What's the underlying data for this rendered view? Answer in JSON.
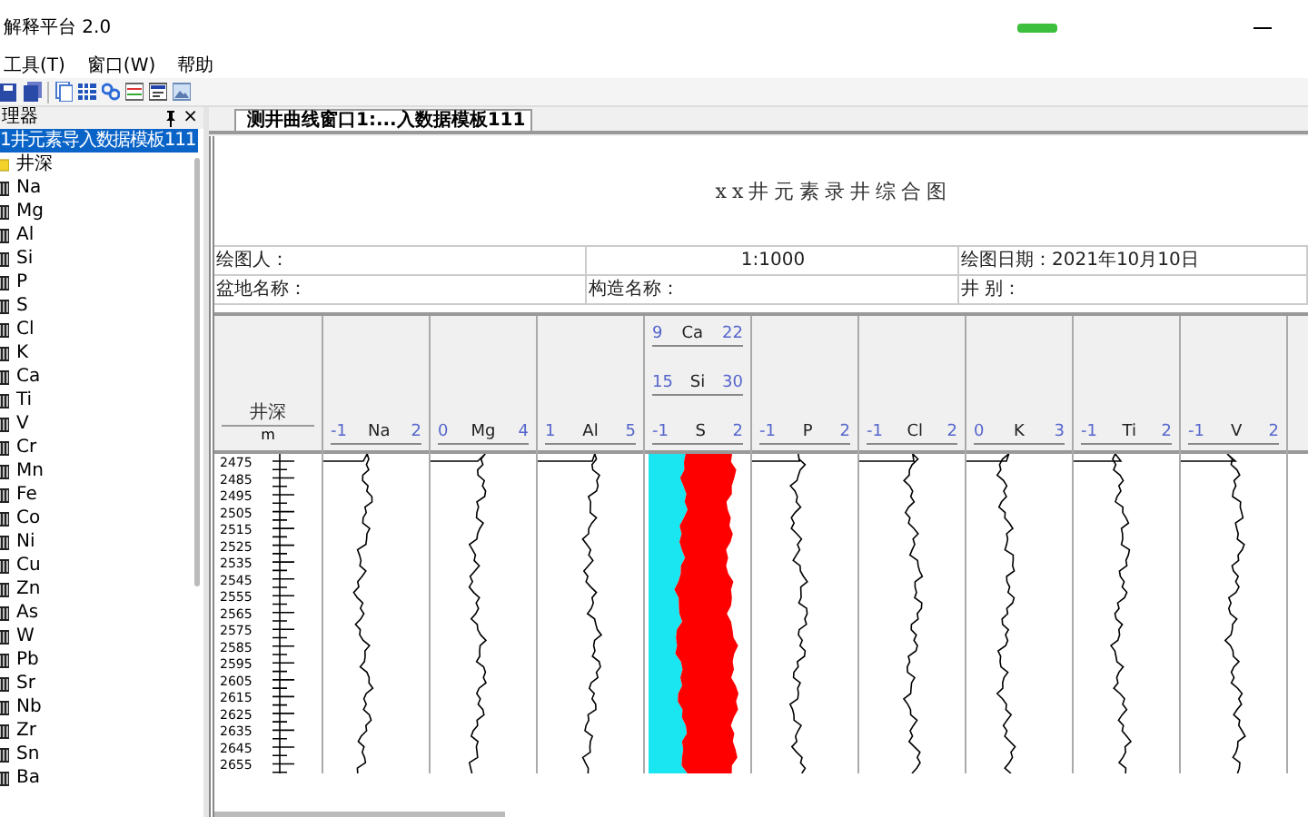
{
  "window": {
    "title": "解释平台 2.0"
  },
  "menu": [
    "工具(T)",
    "窗口(W)",
    "帮助"
  ],
  "panel": {
    "title": "理器",
    "close": "×",
    "root": {
      "label": "1井元素导入数据模板111",
      "selected": true,
      "children": [
        {
          "label": "井深",
          "kind": "folder",
          "selected": false
        },
        {
          "label": "Na",
          "kind": "curve",
          "selected": false
        },
        {
          "label": "Mg",
          "kind": "curve",
          "selected": false
        },
        {
          "label": "Al",
          "kind": "curve",
          "selected": false
        },
        {
          "label": "Si",
          "kind": "curve",
          "selected": false
        },
        {
          "label": "P",
          "kind": "curve",
          "selected": false
        },
        {
          "label": "S",
          "kind": "curve",
          "selected": false
        },
        {
          "label": "Cl",
          "kind": "curve",
          "selected": false
        },
        {
          "label": "K",
          "kind": "curve",
          "selected": false
        },
        {
          "label": "Ca",
          "kind": "curve",
          "selected": false
        },
        {
          "label": "Ti",
          "kind": "curve",
          "selected": false
        },
        {
          "label": "V",
          "kind": "curve",
          "selected": false
        },
        {
          "label": "Cr",
          "kind": "curve",
          "selected": false
        },
        {
          "label": "Mn",
          "kind": "curve",
          "selected": false
        },
        {
          "label": "Fe",
          "kind": "curve",
          "selected": false
        },
        {
          "label": "Co",
          "kind": "curve",
          "selected": false
        },
        {
          "label": "Ni",
          "kind": "curve",
          "selected": false
        },
        {
          "label": "Cu",
          "kind": "curve",
          "selected": false
        },
        {
          "label": "Zn",
          "kind": "curve",
          "selected": false
        },
        {
          "label": "As",
          "kind": "curve",
          "selected": false
        },
        {
          "label": "W",
          "kind": "curve",
          "selected": false
        },
        {
          "label": "Pb",
          "kind": "curve",
          "selected": false
        },
        {
          "label": "Sr",
          "kind": "curve",
          "selected": false
        },
        {
          "label": "Nb",
          "kind": "curve",
          "selected": false
        },
        {
          "label": "Zr",
          "kind": "curve",
          "selected": false
        },
        {
          "label": "Sn",
          "kind": "curve",
          "selected": false
        },
        {
          "label": "Ba",
          "kind": "curve",
          "selected": false
        }
      ]
    }
  },
  "tabs": [
    {
      "label": "测井曲线窗口1:...入数据模板111",
      "selected": true
    }
  ],
  "document": {
    "title": "xx井元素录井综合图",
    "info_rows": [
      [
        "绘图人：",
        "1:1000",
        "绘图日期：2021年10月10日"
      ],
      [
        "盆地名称：",
        "构造名称：",
        "井 别："
      ]
    ],
    "depth_track": {
      "name": "井深",
      "unit": "m",
      "labels": [
        "2475",
        "2485",
        "2495",
        "2505",
        "2515",
        "2525",
        "2535",
        "2545",
        "2555",
        "2565",
        "2575",
        "2585",
        "2595",
        "2605",
        "2615",
        "2625",
        "2635",
        "2645",
        "2655"
      ]
    },
    "tracks": [
      {
        "kind": "curve",
        "name": "Na",
        "min": "-1",
        "max": "2"
      },
      {
        "kind": "curve",
        "name": "Mg",
        "min": "0",
        "max": "4"
      },
      {
        "kind": "curve",
        "name": "Al",
        "min": "1",
        "max": "5"
      },
      {
        "kind": "fill",
        "name": "S",
        "min": "-1",
        "max": "2",
        "extra_scales": [
          {
            "name": "Ca",
            "min": "9",
            "max": "22"
          },
          {
            "name": "Si",
            "min": "15",
            "max": "30"
          }
        ]
      },
      {
        "kind": "curve",
        "name": "P",
        "min": "-1",
        "max": "2"
      },
      {
        "kind": "curve",
        "name": "Cl",
        "min": "-1",
        "max": "2"
      },
      {
        "kind": "curve",
        "name": "K",
        "min": "0",
        "max": "3"
      },
      {
        "kind": "curve",
        "name": "Ti",
        "min": "-1",
        "max": "2"
      },
      {
        "kind": "curve",
        "name": "V",
        "min": "-1",
        "max": "2"
      },
      {
        "kind": "empty"
      }
    ]
  }
}
